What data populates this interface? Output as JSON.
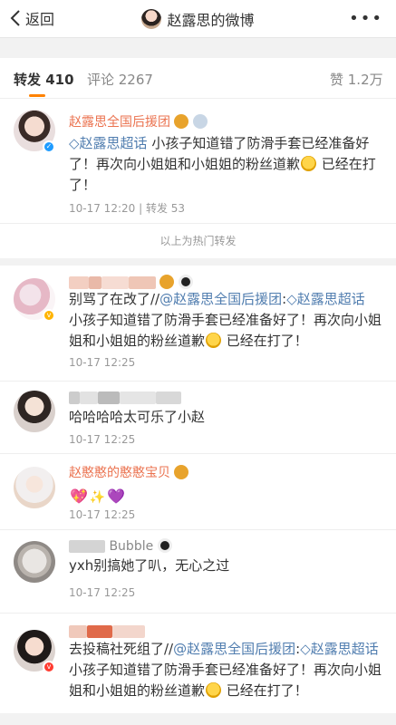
{
  "nav": {
    "back_label": "返回",
    "title": "赵露思的微博",
    "more": "•••"
  },
  "tabs": {
    "repost": "转发 410",
    "comment": "评论 2267",
    "like": "赞 1.2万"
  },
  "hot_divider": "以上为热门转发",
  "items": [
    {
      "name": "赵露思全国后援团",
      "content_link": "◇赵露思超话",
      "content_text": " 小孩子知道错了防滑手套已经准备好了！再次向小姐姐和小姐姐的粉丝道歉",
      "content_tail": " 已经在打了！",
      "time": "10-17 12:20",
      "sep": " | ",
      "repost_count": "转发 53"
    },
    {
      "content_prefix": "别骂了在改了//",
      "content_link1": "@赵露思全国后援团",
      "content_mid": ":",
      "content_link2": "◇赵露思超话",
      "content_text": " 小孩子知道错了防滑手套已经准备好了！再次向小姐姐和小姐姐的粉丝道歉",
      "content_tail": " 已经在打了！",
      "time": "10-17 12:25"
    },
    {
      "content": "哈哈哈哈太可乐了小赵",
      "time": "10-17 12:25"
    },
    {
      "name": "赵憨憨的憨憨宝贝",
      "time": "10-17 12:25"
    },
    {
      "name_visible": "Bubble",
      "content": "yxh别搞她了叭，无心之过",
      "time": "10-17 12:25"
    },
    {
      "content_prefix": "去投稿社死组了//",
      "content_link1": "@赵露思全国后援团",
      "content_mid": ":",
      "content_link2": "◇赵露思超话",
      "content_text": "小孩子知道错了防滑手套已经准备好了！再次向小姐姐和小姐姐的粉丝道歉",
      "content_tail": " 已经在打了！"
    }
  ],
  "colors": {
    "accent": "#ff8200",
    "name_orange": "#eb7350",
    "link_blue": "#507daf",
    "meta_gray": "#999999"
  }
}
